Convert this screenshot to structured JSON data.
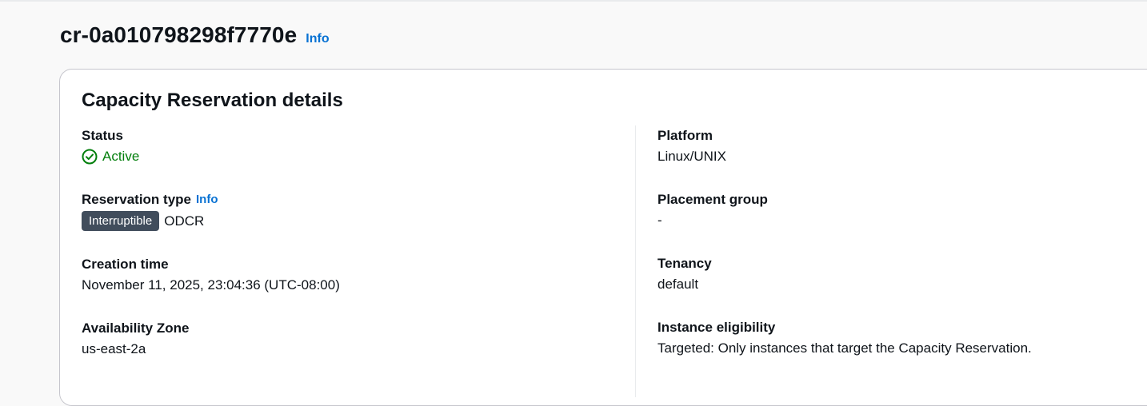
{
  "header": {
    "title": "cr-0a010798298f7770e",
    "info_label": "Info"
  },
  "details": {
    "title": "Capacity Reservation details",
    "left": {
      "status": {
        "label": "Status",
        "value": "Active",
        "icon": "check-circle-icon",
        "color": "#037f0c"
      },
      "reservation_type": {
        "label": "Reservation type",
        "info_label": "Info",
        "badge": "Interruptible",
        "value": "ODCR"
      },
      "creation_time": {
        "label": "Creation time",
        "value": "November 11, 2025, 23:04:36 (UTC-08:00)"
      },
      "availability_zone": {
        "label": "Availability Zone",
        "value": "us-east-2a"
      }
    },
    "right": {
      "platform": {
        "label": "Platform",
        "value": "Linux/UNIX"
      },
      "placement_group": {
        "label": "Placement group",
        "value": "-"
      },
      "tenancy": {
        "label": "Tenancy",
        "value": "default"
      },
      "instance_eligibility": {
        "label": "Instance eligibility",
        "value": "Targeted: Only instances that target the Capacity Reservation."
      }
    }
  },
  "colors": {
    "link": "#0972d3",
    "success": "#037f0c",
    "badge_bg": "#414d5c"
  }
}
